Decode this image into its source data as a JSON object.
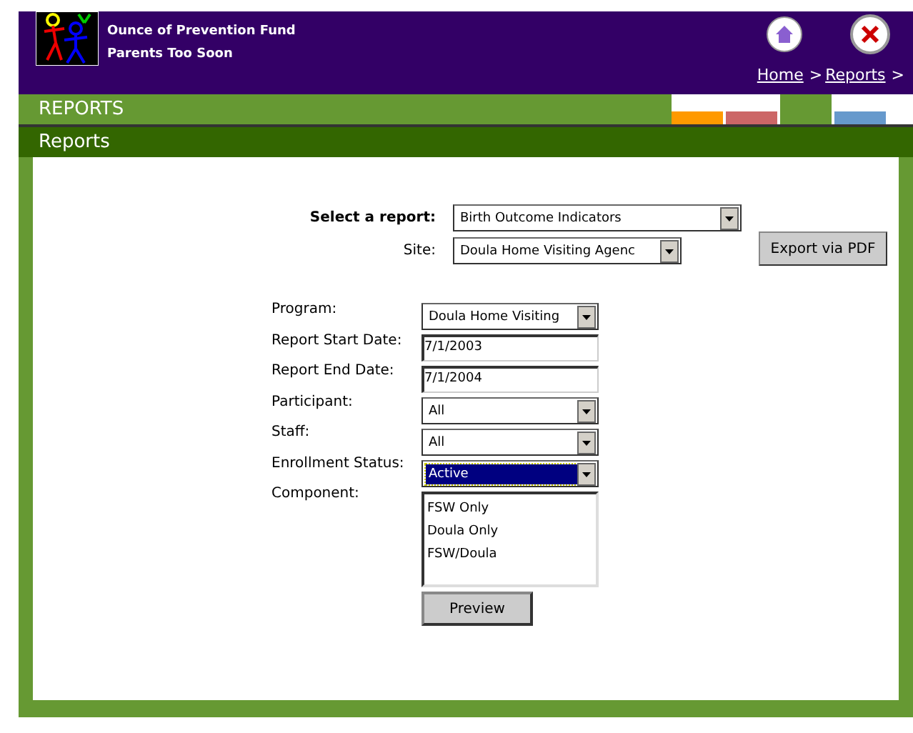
{
  "header": {
    "org_name": "Ounce of Prevention Fund",
    "program_name": "Parents Too Soon"
  },
  "breadcrumb": [
    {
      "label": "Home",
      "kind": "link"
    },
    {
      "label": ">",
      "kind": "separator"
    },
    {
      "label": "Reports",
      "kind": "link"
    },
    {
      "label": ">",
      "kind": "separator"
    }
  ],
  "section_tabs": [
    {
      "color": "#ff9900",
      "selected": false
    },
    {
      "color": "#cc6666",
      "selected": false
    },
    {
      "color": "#669933",
      "selected": true
    },
    {
      "color": "#6699cc",
      "selected": false
    }
  ],
  "section_title": "REPORTS",
  "page_title": "Reports",
  "report_select": {
    "label": "Select a report:",
    "value": "Birth Outcome Indicators"
  },
  "site_select": {
    "label": "Site:",
    "value": "Doula Home Visiting Agenc"
  },
  "export_button": "Export via PDF",
  "fields": [
    {
      "label": "Program:",
      "kind": "select",
      "value": "Doula Home Visiting",
      "focused": false
    },
    {
      "label": "Report Start Date:",
      "kind": "text",
      "value": "7/1/2003",
      "focused": false
    },
    {
      "label": "Report End Date:",
      "kind": "text",
      "value": "7/1/2004",
      "focused": false
    },
    {
      "label": "Participant:",
      "kind": "select",
      "value": "All",
      "focused": false
    },
    {
      "label": "Staff:",
      "kind": "select",
      "value": "All",
      "focused": false
    },
    {
      "label": "Enrollment Status:",
      "kind": "select",
      "value": "Active",
      "focused": true
    },
    {
      "label": "Component:",
      "kind": "listbox",
      "options": [
        {
          "label": "FSW Only",
          "selected": false
        },
        {
          "label": "Doula Only",
          "selected": false
        },
        {
          "label": "FSW/Doula",
          "selected": false
        }
      ]
    }
  ],
  "preview_button": "Preview"
}
